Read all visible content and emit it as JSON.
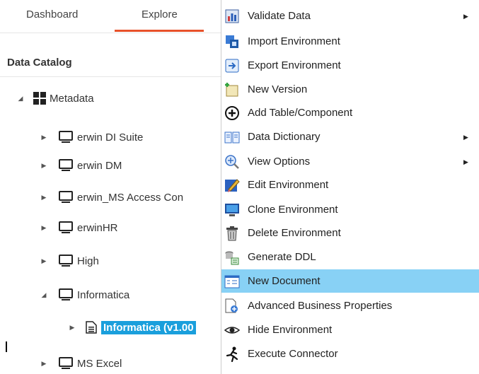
{
  "tabs": {
    "dashboard": "Dashboard",
    "explore": "Explore"
  },
  "catalog": {
    "title": "Data Catalog"
  },
  "tree": {
    "root": {
      "label": "Metadata",
      "icon": "grid-icon"
    },
    "nodes": [
      {
        "label": "erwin DI Suite",
        "icon": "monitor-icon"
      },
      {
        "label": "erwin DM",
        "icon": "monitor-icon"
      },
      {
        "label": "erwin_MS Access Con",
        "icon": "monitor-icon"
      },
      {
        "label": "erwinHR",
        "icon": "monitor-icon"
      },
      {
        "label": "High",
        "icon": "monitor-icon"
      },
      {
        "label": "Informatica",
        "icon": "monitor-icon"
      },
      {
        "label": "Informatica (v1.00",
        "icon": "document-icon"
      },
      {
        "label": "MS Excel",
        "icon": "monitor-icon"
      }
    ]
  },
  "menu": {
    "items": [
      {
        "label": "Validate Data",
        "icon": "bar-chart-icon",
        "submenu": true
      },
      {
        "label": "Import Environment",
        "icon": "import-icon",
        "submenu": false
      },
      {
        "label": "Export Environment",
        "icon": "export-icon",
        "submenu": false
      },
      {
        "label": "New Version",
        "icon": "new-version-icon",
        "submenu": false
      },
      {
        "label": "Add Table/Component",
        "icon": "add-circle-icon",
        "submenu": false
      },
      {
        "label": "Data Dictionary",
        "icon": "book-icon",
        "submenu": true
      },
      {
        "label": "View Options",
        "icon": "zoom-icon",
        "submenu": true
      },
      {
        "label": "Edit Environment",
        "icon": "edit-icon",
        "submenu": false
      },
      {
        "label": "Clone Environment",
        "icon": "clone-icon",
        "submenu": false
      },
      {
        "label": "Delete Environment",
        "icon": "trash-icon",
        "submenu": false
      },
      {
        "label": "Generate DDL",
        "icon": "ddl-icon",
        "submenu": false
      },
      {
        "label": "New Document",
        "icon": "new-document-icon",
        "submenu": false,
        "highlighted": true
      },
      {
        "label": "Advanced Business Properties",
        "icon": "properties-icon",
        "submenu": false
      },
      {
        "label": "Hide Environment",
        "icon": "eye-icon",
        "submenu": false
      },
      {
        "label": "Execute Connector",
        "icon": "run-icon",
        "submenu": false
      }
    ],
    "submenu_arrow": "▶"
  },
  "colors": {
    "accent": "#e8512a",
    "selection": "#1a9fdc",
    "menu_highlight": "#88d1f5"
  }
}
